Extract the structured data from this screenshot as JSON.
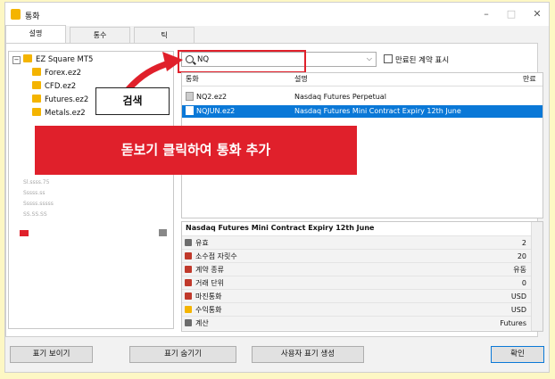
{
  "window": {
    "title": "통화",
    "controls": {
      "minimize": "–",
      "maximize": "□",
      "close": "✕"
    }
  },
  "tabs": [
    "설명",
    "통수",
    "틱"
  ],
  "tree": {
    "root": "EZ Square MT5",
    "items": [
      "Forex.ez2",
      "CFD.ez2",
      "Futures.ez2",
      "Metals.ez2"
    ],
    "blurred_lines": [
      "Sl.ssss.75",
      "Sssss.ss",
      "Sssss.sssss",
      "SS.SS.SS"
    ]
  },
  "search": {
    "value": "NQ",
    "show_expired_label": "만료된 계약 표시"
  },
  "grid": {
    "columns": [
      "통화",
      "설명",
      "만료"
    ],
    "rows": [
      {
        "symbol": "NQ2.ez2",
        "description": "Nasdaq Futures Perpetual",
        "expiry": ""
      },
      {
        "symbol": "NQJUN.ez2",
        "description": "Nasdaq Futures Mini Contract Expiry 12th June",
        "expiry": ""
      }
    ]
  },
  "properties": {
    "header": "Nasdaq Futures Mini Contract Expiry 12th June",
    "rows": [
      {
        "label": "유효",
        "value": "2",
        "icon_color": "#6c6c6c"
      },
      {
        "label": "소수점 자릿수",
        "value": "20",
        "icon_color": "#c0392b"
      },
      {
        "label": "계약 종류",
        "value": "유동",
        "icon_color": "#c0392b"
      },
      {
        "label": "거래 단위",
        "value": "0",
        "icon_color": "#c0392b"
      },
      {
        "label": "마진통화",
        "value": "USD",
        "icon_color": "#c0392b"
      },
      {
        "label": "수익통화",
        "value": "USD",
        "icon_color": "#f4b400"
      },
      {
        "label": "계산",
        "value": "Futures",
        "icon_color": "#6c6c6c"
      }
    ]
  },
  "buttons": {
    "show_symbol": "표기 보이기",
    "hide_symbol": "표기 숨기기",
    "create_custom": "사용자 표기 생성",
    "ok": "확인"
  },
  "annotations": {
    "search_callout": "검색",
    "banner": "돋보기 클릭하여 통화 추가"
  },
  "colors": {
    "highlight_red": "#e0202b",
    "selection_blue": "#0a78d7",
    "folder_yellow": "#f4b400",
    "page_bg": "#fdf7c4"
  }
}
